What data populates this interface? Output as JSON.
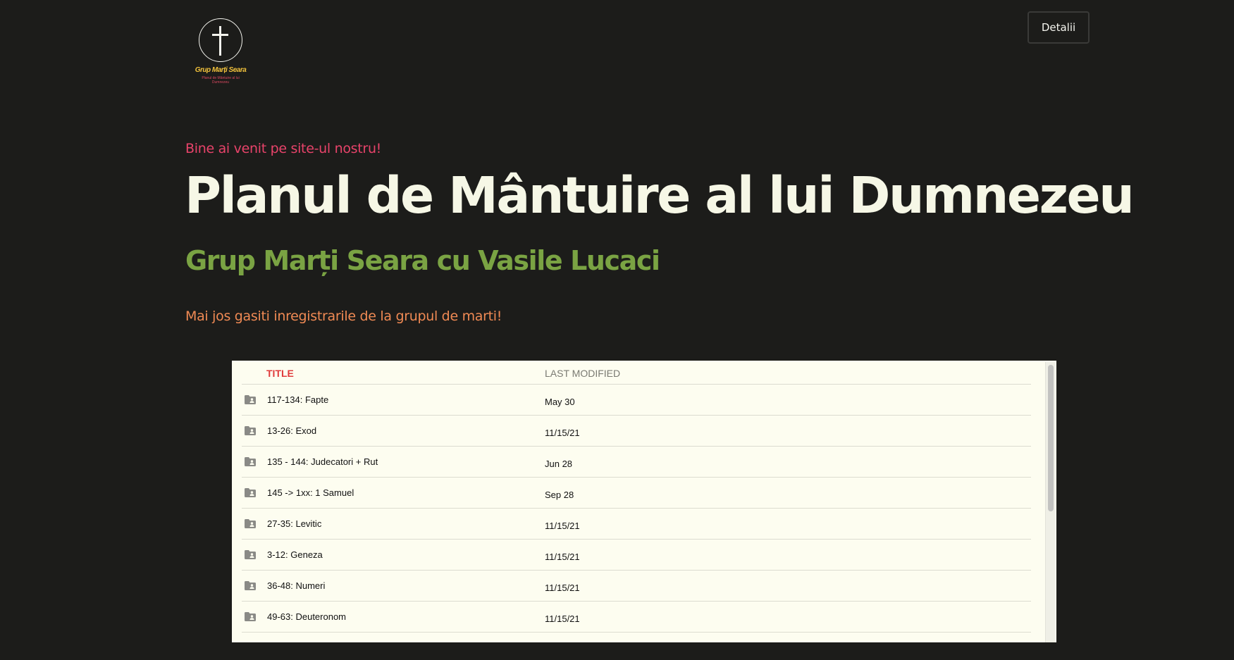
{
  "logo": {
    "title": "Grup Marți Seara",
    "subtitle": "Planul de Mântuire al lui Dumnezeu"
  },
  "header": {
    "details_label": "Detalii"
  },
  "hero": {
    "welcome": "Bine ai venit pe site-ul nostru!",
    "title": "Planul de Mântuire al lui Dumnezeu",
    "subtitle": "Grup Marți Seara cu Vasile Lucaci",
    "intro": "Mai jos gasiti inregistrarile de la grupul de marti!"
  },
  "files": {
    "columns": {
      "title": "TITLE",
      "last_modified": "LAST MODIFIED"
    },
    "rows": [
      {
        "name": "117-134: Fapte",
        "modified": "May 30",
        "icon": "shared-folder-icon"
      },
      {
        "name": "13-26: Exod",
        "modified": "11/15/21",
        "icon": "shared-folder-icon"
      },
      {
        "name": "135 - 144: Judecatori + Rut",
        "modified": "Jun 28",
        "icon": "shared-folder-icon"
      },
      {
        "name": "145 -> 1xx: 1 Samuel",
        "modified": "Sep 28",
        "icon": "shared-folder-icon"
      },
      {
        "name": "27-35: Levitic",
        "modified": "11/15/21",
        "icon": "shared-folder-icon"
      },
      {
        "name": "3-12: Geneza",
        "modified": "11/15/21",
        "icon": "shared-folder-icon"
      },
      {
        "name": "36-48: Numeri",
        "modified": "11/15/21",
        "icon": "shared-folder-icon"
      },
      {
        "name": "49-63: Deuteronom",
        "modified": "11/15/21",
        "icon": "shared-folder-icon"
      }
    ]
  },
  "colors": {
    "background": "#1c1c1a",
    "welcome": "#e8436a",
    "title": "#f6f7e6",
    "subtitle": "#7aa343",
    "intro": "#f08a54",
    "table_header_active": "#e03b3b",
    "panel_background": "#fdfdf0"
  }
}
